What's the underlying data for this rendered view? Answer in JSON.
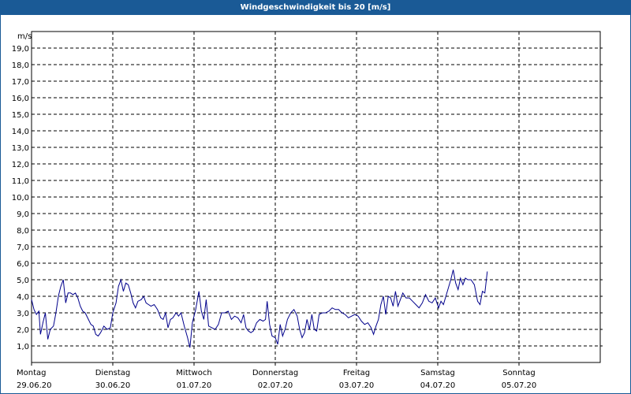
{
  "title": "Windgeschwindigkeit bis 20 [m/s]",
  "colors": {
    "title_bar": "#1a5a96",
    "title_text": "#ffffff",
    "line": "#00008b",
    "grid": "#000000"
  },
  "chart_data": {
    "type": "line",
    "title": "Windgeschwindigkeit bis 20 [m/s]",
    "ylabel": "m/s",
    "ylim": [
      0,
      20
    ],
    "grid": true,
    "y_ticks": [
      "1,0",
      "2,0",
      "3,0",
      "4,0",
      "5,0",
      "6,0",
      "7,0",
      "8,0",
      "9,0",
      "10,0",
      "11,0",
      "12,0",
      "13,0",
      "14,0",
      "15,0",
      "16,0",
      "17,0",
      "18,0",
      "19,0"
    ],
    "x_ticks": [
      {
        "day": "Montag",
        "date": "29.06.20"
      },
      {
        "day": "Dienstag",
        "date": "30.06.20"
      },
      {
        "day": "Mittwoch",
        "date": "01.07.20"
      },
      {
        "day": "Donnerstag",
        "date": "02.07.20"
      },
      {
        "day": "Freitag",
        "date": "03.07.20"
      },
      {
        "day": "Samstag",
        "date": "04.07.20"
      },
      {
        "day": "Sonntag",
        "date": "05.07.20"
      }
    ],
    "x_range_days": [
      0,
      7
    ],
    "series": [
      {
        "points": [
          [
            0.0,
            3.8
          ],
          [
            0.03,
            3.2
          ],
          [
            0.06,
            2.9
          ],
          [
            0.09,
            3.1
          ],
          [
            0.11,
            1.7
          ],
          [
            0.14,
            2.4
          ],
          [
            0.17,
            3.0
          ],
          [
            0.2,
            1.4
          ],
          [
            0.23,
            2.0
          ],
          [
            0.27,
            2.2
          ],
          [
            0.3,
            3.0
          ],
          [
            0.33,
            4.0
          ],
          [
            0.36,
            4.6
          ],
          [
            0.39,
            5.0
          ],
          [
            0.42,
            3.6
          ],
          [
            0.45,
            4.2
          ],
          [
            0.48,
            4.2
          ],
          [
            0.51,
            4.1
          ],
          [
            0.54,
            4.2
          ],
          [
            0.57,
            3.9
          ],
          [
            0.6,
            3.4
          ],
          [
            0.63,
            3.1
          ],
          [
            0.66,
            3.0
          ],
          [
            0.7,
            2.6
          ],
          [
            0.73,
            2.3
          ],
          [
            0.76,
            2.2
          ],
          [
            0.79,
            1.7
          ],
          [
            0.82,
            1.6
          ],
          [
            0.85,
            1.8
          ],
          [
            0.89,
            2.2
          ],
          [
            0.93,
            2.0
          ],
          [
            0.97,
            2.1
          ],
          [
            1.0,
            3.0
          ],
          [
            1.04,
            3.6
          ],
          [
            1.07,
            4.6
          ],
          [
            1.1,
            5.0
          ],
          [
            1.13,
            4.3
          ],
          [
            1.16,
            4.8
          ],
          [
            1.19,
            4.7
          ],
          [
            1.22,
            4.2
          ],
          [
            1.25,
            3.6
          ],
          [
            1.28,
            3.3
          ],
          [
            1.31,
            3.7
          ],
          [
            1.35,
            3.8
          ],
          [
            1.38,
            4.0
          ],
          [
            1.41,
            3.6
          ],
          [
            1.44,
            3.5
          ],
          [
            1.47,
            3.4
          ],
          [
            1.51,
            3.5
          ],
          [
            1.55,
            3.2
          ],
          [
            1.59,
            2.7
          ],
          [
            1.62,
            2.6
          ],
          [
            1.65,
            3.0
          ],
          [
            1.68,
            2.1
          ],
          [
            1.71,
            2.6
          ],
          [
            1.74,
            2.7
          ],
          [
            1.78,
            3.0
          ],
          [
            1.81,
            2.8
          ],
          [
            1.84,
            3.0
          ],
          [
            1.88,
            2.2
          ],
          [
            1.92,
            1.5
          ],
          [
            1.95,
            0.9
          ],
          [
            1.98,
            2.4
          ],
          [
            2.02,
            3.2
          ],
          [
            2.06,
            4.3
          ],
          [
            2.09,
            3.1
          ],
          [
            2.12,
            2.6
          ],
          [
            2.15,
            3.8
          ],
          [
            2.18,
            2.2
          ],
          [
            2.22,
            2.1
          ],
          [
            2.26,
            2.0
          ],
          [
            2.3,
            2.3
          ],
          [
            2.34,
            3.0
          ],
          [
            2.38,
            3.0
          ],
          [
            2.42,
            3.1
          ],
          [
            2.46,
            2.6
          ],
          [
            2.5,
            2.8
          ],
          [
            2.54,
            2.7
          ],
          [
            2.58,
            2.4
          ],
          [
            2.61,
            2.9
          ],
          [
            2.64,
            2.1
          ],
          [
            2.67,
            1.9
          ],
          [
            2.7,
            1.8
          ],
          [
            2.73,
            1.9
          ],
          [
            2.77,
            2.4
          ],
          [
            2.81,
            2.6
          ],
          [
            2.85,
            2.5
          ],
          [
            2.88,
            2.6
          ],
          [
            2.9,
            3.7
          ],
          [
            2.93,
            2.3
          ],
          [
            2.96,
            1.6
          ],
          [
            3.0,
            1.5
          ],
          [
            3.03,
            1.1
          ],
          [
            3.06,
            2.3
          ],
          [
            3.09,
            1.6
          ],
          [
            3.12,
            2.0
          ],
          [
            3.15,
            2.6
          ],
          [
            3.19,
            3.0
          ],
          [
            3.23,
            3.2
          ],
          [
            3.27,
            2.8
          ],
          [
            3.3,
            2.0
          ],
          [
            3.33,
            1.5
          ],
          [
            3.36,
            1.8
          ],
          [
            3.39,
            2.6
          ],
          [
            3.42,
            2.0
          ],
          [
            3.45,
            2.9
          ],
          [
            3.48,
            2.0
          ],
          [
            3.51,
            1.9
          ],
          [
            3.54,
            2.9
          ],
          [
            3.58,
            3.0
          ],
          [
            3.62,
            3.0
          ],
          [
            3.66,
            3.1
          ],
          [
            3.7,
            3.3
          ],
          [
            3.74,
            3.2
          ],
          [
            3.78,
            3.2
          ],
          [
            3.82,
            3.0
          ],
          [
            3.86,
            2.9
          ],
          [
            3.9,
            2.7
          ],
          [
            3.94,
            2.8
          ],
          [
            3.98,
            2.9
          ],
          [
            4.02,
            2.8
          ],
          [
            4.06,
            2.5
          ],
          [
            4.1,
            2.3
          ],
          [
            4.14,
            2.4
          ],
          [
            4.18,
            2.1
          ],
          [
            4.21,
            1.7
          ],
          [
            4.24,
            2.2
          ],
          [
            4.27,
            2.6
          ],
          [
            4.3,
            3.5
          ],
          [
            4.33,
            4.0
          ],
          [
            4.36,
            2.9
          ],
          [
            4.39,
            4.0
          ],
          [
            4.42,
            3.9
          ],
          [
            4.45,
            3.4
          ],
          [
            4.48,
            4.3
          ],
          [
            4.51,
            3.4
          ],
          [
            4.54,
            3.8
          ],
          [
            4.57,
            4.2
          ],
          [
            4.61,
            3.9
          ],
          [
            4.65,
            3.9
          ],
          [
            4.69,
            3.7
          ],
          [
            4.73,
            3.5
          ],
          [
            4.77,
            3.3
          ],
          [
            4.81,
            3.6
          ],
          [
            4.85,
            4.1
          ],
          [
            4.89,
            3.7
          ],
          [
            4.93,
            3.6
          ],
          [
            4.97,
            3.9
          ],
          [
            5.01,
            3.3
          ],
          [
            5.04,
            3.7
          ],
          [
            5.07,
            3.5
          ],
          [
            5.1,
            4.0
          ],
          [
            5.13,
            4.5
          ],
          [
            5.16,
            5.0
          ],
          [
            5.19,
            5.6
          ],
          [
            5.22,
            4.8
          ],
          [
            5.25,
            4.4
          ],
          [
            5.28,
            5.1
          ],
          [
            5.31,
            4.7
          ],
          [
            5.34,
            5.1
          ],
          [
            5.37,
            5.0
          ],
          [
            5.41,
            5.0
          ],
          [
            5.45,
            4.7
          ],
          [
            5.49,
            3.7
          ],
          [
            5.52,
            3.5
          ],
          [
            5.55,
            4.3
          ],
          [
            5.58,
            4.2
          ],
          [
            5.61,
            5.5
          ]
        ]
      }
    ]
  }
}
